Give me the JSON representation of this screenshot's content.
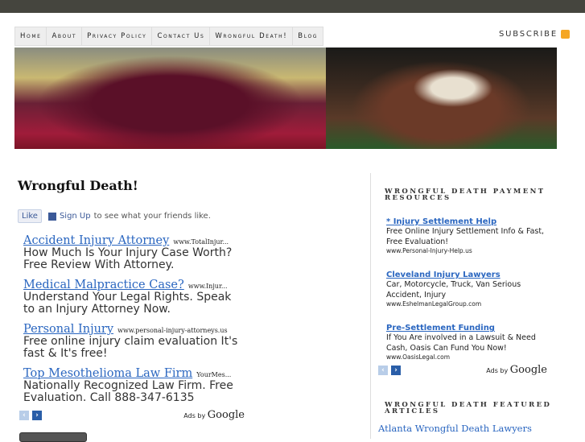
{
  "nav": [
    "Home",
    "About",
    "Privacy Policy",
    "Contact Us",
    "Wrongful Death!",
    "Blog"
  ],
  "subscribe": "SUBSCRIBE",
  "title": "Wrongful Death!",
  "fb": {
    "like": "Like",
    "signup": "Sign Up",
    "rest": "to see what your friends like."
  },
  "ads": [
    {
      "title": "Accident Injury Attorney",
      "url": "www.TotalInjur...",
      "desc": "How Much Is Your Injury Case Worth? Free Review With Attorney."
    },
    {
      "title": "Medical Malpractice Case?",
      "url": "www.Injur...",
      "desc": "Understand Your Legal Rights. Speak to an Injury Attorney Now."
    },
    {
      "title": "Personal Injury",
      "url": "www.personal-injury-attorneys.us",
      "desc": "Free online injury claim evaluation It's fast & It's free!"
    },
    {
      "title": "Top Mesothelioma Law Firm",
      "url": "YourMes...",
      "desc": "Nationally Recognized Law Firm. Free Evaluation. Call 888-347-6135"
    }
  ],
  "adsby": "Ads by",
  "google": "Google",
  "sidebar": {
    "h1": "WRONGFUL DEATH PAYMENT RESOURCES",
    "ads": [
      {
        "title": "* Injury Settlement Help",
        "desc": "Free Online Injury Settlement Info & Fast, Free Evaluation!",
        "url": "www.Personal-Injury-Help.us"
      },
      {
        "title": "Cleveland Injury Lawyers",
        "desc": "Car, Motorcycle, Truck, Van Serious Accident, Injury",
        "url": "www.EshelmanLegalGroup.com"
      },
      {
        "title": "Pre-Settlement Funding",
        "desc": "If You Are involved in a Lawsuit & Need Cash, Oasis Can Fund You Now!",
        "url": "www.OasisLegal.com"
      }
    ],
    "h2": "WRONGFUL DEATH FEATURED ARTICLES",
    "article": "Atlanta Wrongful Death Lawyers"
  }
}
